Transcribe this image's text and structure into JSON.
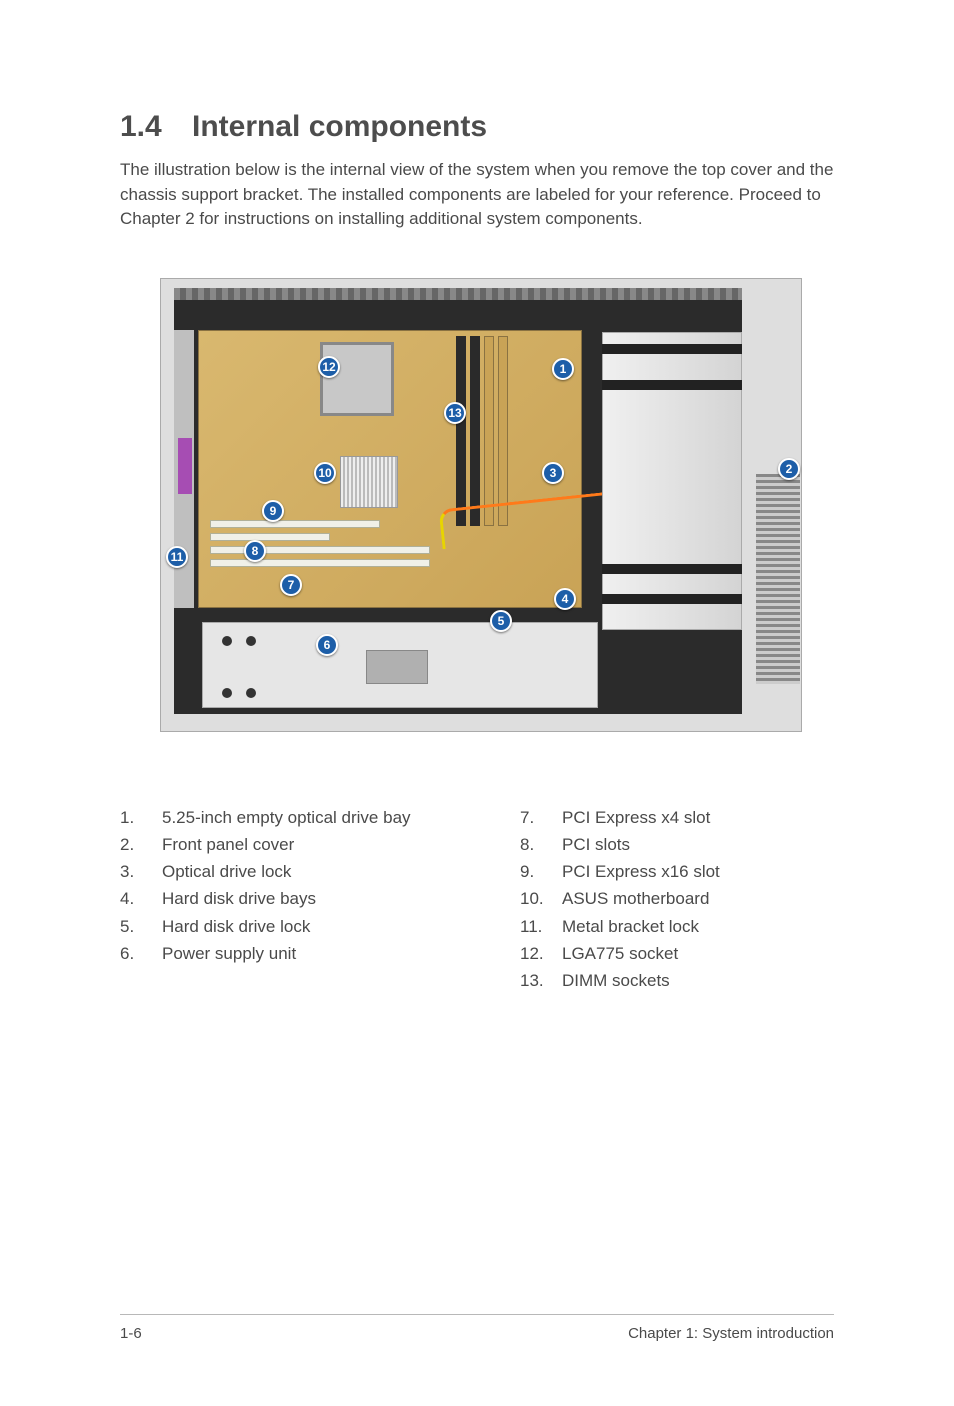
{
  "heading": {
    "number": "1.4",
    "title": "Internal components"
  },
  "intro": "The illustration below is the internal view of the system when you remove the top cover and the chassis support bracket. The installed components are labeled for your reference. Proceed to Chapter 2 for instructions on installing additional system components.",
  "callouts": {
    "c1": "1",
    "c2": "2",
    "c3": "3",
    "c4": "4",
    "c5": "5",
    "c6": "6",
    "c7": "7",
    "c8": "8",
    "c9": "9",
    "c10": "10",
    "c11": "11",
    "c12": "12",
    "c13": "13"
  },
  "list_left": {
    "n1": "1.",
    "l1": "5.25-inch empty optical drive bay",
    "n2": "2.",
    "l2": "Front panel cover",
    "n3": "3.",
    "l3": "Optical drive lock",
    "n4": "4.",
    "l4": "Hard disk drive bays",
    "n5": "5.",
    "l5": "Hard disk drive lock",
    "n6": "6.",
    "l6": "Power supply unit"
  },
  "list_right": {
    "n7": "7.",
    "l7": "PCI Express x4 slot",
    "n8": "8.",
    "l8": "PCI slots",
    "n9": "9.",
    "l9": "PCI Express x16 slot",
    "n10": "10.",
    "l10": "ASUS motherboard",
    "n11": "11.",
    "l11": "Metal bracket lock",
    "n12": "12.",
    "l12": "LGA775 socket",
    "n13": "13.",
    "l13": "DIMM sockets"
  },
  "footer": {
    "left": "1-6",
    "right": "Chapter 1: System introduction"
  }
}
